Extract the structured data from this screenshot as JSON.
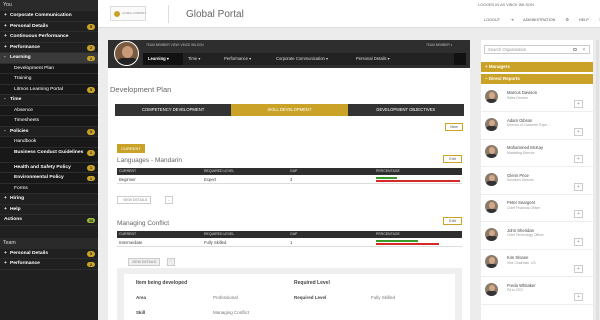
{
  "sidebar": {
    "you_header": "You",
    "items": [
      {
        "pm": "+",
        "label": "Corporate Communication",
        "badge": ""
      },
      {
        "pm": "+",
        "label": "Personal Details",
        "badge": "5"
      },
      {
        "pm": "+",
        "label": "Continuous Performance",
        "badge": ""
      },
      {
        "pm": "+",
        "label": "Performance",
        "badge": "2"
      },
      {
        "pm": "-",
        "label": "Learning",
        "badge": "2"
      }
    ],
    "learning_sub": [
      "Development Plan",
      "Training",
      "Litmos Learning Portal"
    ],
    "learning_sub_badge": "5",
    "time": {
      "pm": "-",
      "label": "Time"
    },
    "time_sub": [
      "Absence",
      "Timesheets"
    ],
    "policies": {
      "pm": "-",
      "label": "Policies",
      "badge": "5"
    },
    "policies_sub": [
      {
        "label": "Handbook",
        "badge": ""
      },
      {
        "label": "Business Conduct Guidelines",
        "badge": "1"
      },
      {
        "label": "Health and Safety Policy",
        "badge": "1"
      },
      {
        "label": "Environmental Policy",
        "badge": "1"
      },
      {
        "label": "Forms",
        "badge": ""
      }
    ],
    "hiring": {
      "pm": "+",
      "label": "Hiring"
    },
    "help": {
      "pm": "+",
      "label": "Help"
    },
    "actions": {
      "label": "Actions",
      "badge": "38"
    },
    "team_header": "Team",
    "team_items": [
      {
        "pm": "+",
        "label": "Personal Details",
        "badge": "5"
      },
      {
        "pm": "+",
        "label": "Performance",
        "badge": "2"
      }
    ]
  },
  "topbar": {
    "logo_text": "GLOBAL COMPANY",
    "title": "Global Portal",
    "logged_in": "LOGGED IN AS VINCE WILSON",
    "logout": "LOGOUT",
    "administration": "ADMINISTRATION",
    "help": "HELP"
  },
  "profile": {
    "label": "TEAM MEMBER VIEW: VINCE WILSON",
    "member": "TEAM MEMBER",
    "nav": [
      "Learning",
      "Time",
      "Performance",
      "Corporate Communication",
      "Personal Details"
    ]
  },
  "main": {
    "title": "Development Plan",
    "tabs": [
      "COMPETENCY DEVELOPMENT",
      "SKILL DEVELOPMENT",
      "DEVELOPMENT OBJECTIVES"
    ],
    "new_button": "New",
    "current_tag": "CURRENT",
    "edit_label": "Edit",
    "columns": [
      "CURRENT",
      "REQUIRED LEVEL",
      "GAP",
      "PERCENTAGE"
    ],
    "view_details": "VIEW DETAILS",
    "sections": [
      {
        "title": "Languages - Mandarin",
        "current": "Beginner",
        "required": "Expert",
        "gap": "3",
        "green_pct": 25,
        "red_pct": 100
      },
      {
        "title": "Managing Conflict",
        "current": "Intermediate",
        "required": "Fully Skilled",
        "gap": "1",
        "green_pct": 50,
        "red_pct": 75
      }
    ],
    "detail": {
      "h1": "Item being developed",
      "h2": "Required Level",
      "area_label": "Area",
      "area_value": "Professional",
      "req_label": "Required Level",
      "req_value": "Fully Skilled",
      "skill_label": "Skill",
      "skill_value": "Managing Conflict"
    }
  },
  "right": {
    "search_placeholder": "Search Organisation",
    "managers": "Managers",
    "direct_reports": "Direct Reports",
    "reports": [
      {
        "name": "Marcus Davison",
        "role": "Sales Director"
      },
      {
        "name": "Adam Gibson",
        "role": "Director of Customer Expe..."
      },
      {
        "name": "Mohammed McKay",
        "role": "Marketing Director"
      },
      {
        "name": "Glenn Price",
        "role": "Solutions Director"
      },
      {
        "name": "Peter Seargent",
        "role": "Chief Financial Officer"
      },
      {
        "name": "John Sheridan",
        "role": "Chief Technology Officer"
      },
      {
        "name": "Kim Sloane",
        "role": "Vice Chairman, US"
      },
      {
        "name": "Freda Whitaker",
        "role": "PA to CEO"
      }
    ]
  },
  "colors": {
    "accent": "#c9a227",
    "dark": "#2e2e2e",
    "green": "#3a9a2a",
    "red": "#d42a2a"
  }
}
